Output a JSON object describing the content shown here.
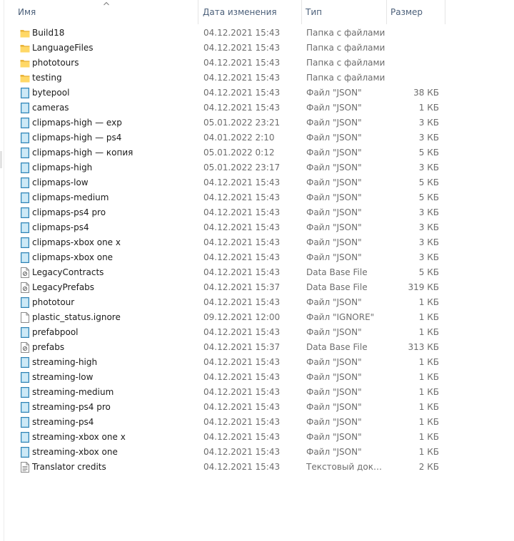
{
  "columns": {
    "name": "Имя",
    "date": "Дата изменения",
    "type": "Тип",
    "size": "Размер"
  },
  "files": [
    {
      "name": "Build18",
      "date": "04.12.2021 15:43",
      "type": "Папка с файлами",
      "size": "",
      "icon": "folder-icon"
    },
    {
      "name": "LanguageFiles",
      "date": "04.12.2021 15:43",
      "type": "Папка с файлами",
      "size": "",
      "icon": "folder-icon"
    },
    {
      "name": "phototours",
      "date": "04.12.2021 15:43",
      "type": "Папка с файлами",
      "size": "",
      "icon": "folder-icon"
    },
    {
      "name": "testing",
      "date": "04.12.2021 15:43",
      "type": "Папка с файлами",
      "size": "",
      "icon": "folder-icon"
    },
    {
      "name": "bytepool",
      "date": "04.12.2021 15:43",
      "type": "Файл \"JSON\"",
      "size": "38 КБ",
      "icon": "json-file-icon"
    },
    {
      "name": "cameras",
      "date": "04.12.2021 15:43",
      "type": "Файл \"JSON\"",
      "size": "1 КБ",
      "icon": "json-file-icon"
    },
    {
      "name": "clipmaps-high — exp",
      "date": "05.01.2022 23:21",
      "type": "Файл \"JSON\"",
      "size": "3 КБ",
      "icon": "json-file-icon"
    },
    {
      "name": "clipmaps-high — ps4",
      "date": "04.01.2022 2:10",
      "type": "Файл \"JSON\"",
      "size": "3 КБ",
      "icon": "json-file-icon"
    },
    {
      "name": "clipmaps-high — копия",
      "date": "05.01.2022 0:12",
      "type": "Файл \"JSON\"",
      "size": "5 КБ",
      "icon": "json-file-icon"
    },
    {
      "name": "clipmaps-high",
      "date": "05.01.2022 23:17",
      "type": "Файл \"JSON\"",
      "size": "3 КБ",
      "icon": "json-file-icon"
    },
    {
      "name": "clipmaps-low",
      "date": "04.12.2021 15:43",
      "type": "Файл \"JSON\"",
      "size": "5 КБ",
      "icon": "json-file-icon"
    },
    {
      "name": "clipmaps-medium",
      "date": "04.12.2021 15:43",
      "type": "Файл \"JSON\"",
      "size": "5 КБ",
      "icon": "json-file-icon"
    },
    {
      "name": "clipmaps-ps4 pro",
      "date": "04.12.2021 15:43",
      "type": "Файл \"JSON\"",
      "size": "3 КБ",
      "icon": "json-file-icon"
    },
    {
      "name": "clipmaps-ps4",
      "date": "04.12.2021 15:43",
      "type": "Файл \"JSON\"",
      "size": "3 КБ",
      "icon": "json-file-icon"
    },
    {
      "name": "clipmaps-xbox one x",
      "date": "04.12.2021 15:43",
      "type": "Файл \"JSON\"",
      "size": "3 КБ",
      "icon": "json-file-icon"
    },
    {
      "name": "clipmaps-xbox one",
      "date": "04.12.2021 15:43",
      "type": "Файл \"JSON\"",
      "size": "3 КБ",
      "icon": "json-file-icon"
    },
    {
      "name": "LegacyContracts",
      "date": "04.12.2021 15:43",
      "type": "Data Base File",
      "size": "5 КБ",
      "icon": "database-file-icon"
    },
    {
      "name": "LegacyPrefabs",
      "date": "04.12.2021 15:37",
      "type": "Data Base File",
      "size": "319 КБ",
      "icon": "database-file-icon"
    },
    {
      "name": "phototour",
      "date": "04.12.2021 15:43",
      "type": "Файл \"JSON\"",
      "size": "1 КБ",
      "icon": "json-file-icon"
    },
    {
      "name": "plastic_status.ignore",
      "date": "09.12.2021 12:00",
      "type": "Файл \"IGNORE\"",
      "size": "1 КБ",
      "icon": "blank-file-icon"
    },
    {
      "name": "prefabpool",
      "date": "04.12.2021 15:43",
      "type": "Файл \"JSON\"",
      "size": "1 КБ",
      "icon": "json-file-icon"
    },
    {
      "name": "prefabs",
      "date": "04.12.2021 15:37",
      "type": "Data Base File",
      "size": "313 КБ",
      "icon": "database-file-icon"
    },
    {
      "name": "streaming-high",
      "date": "04.12.2021 15:43",
      "type": "Файл \"JSON\"",
      "size": "1 КБ",
      "icon": "json-file-icon"
    },
    {
      "name": "streaming-low",
      "date": "04.12.2021 15:43",
      "type": "Файл \"JSON\"",
      "size": "1 КБ",
      "icon": "json-file-icon"
    },
    {
      "name": "streaming-medium",
      "date": "04.12.2021 15:43",
      "type": "Файл \"JSON\"",
      "size": "1 КБ",
      "icon": "json-file-icon"
    },
    {
      "name": "streaming-ps4 pro",
      "date": "04.12.2021 15:43",
      "type": "Файл \"JSON\"",
      "size": "1 КБ",
      "icon": "json-file-icon"
    },
    {
      "name": "streaming-ps4",
      "date": "04.12.2021 15:43",
      "type": "Файл \"JSON\"",
      "size": "1 КБ",
      "icon": "json-file-icon"
    },
    {
      "name": "streaming-xbox one x",
      "date": "04.12.2021 15:43",
      "type": "Файл \"JSON\"",
      "size": "1 КБ",
      "icon": "json-file-icon"
    },
    {
      "name": "streaming-xbox one",
      "date": "04.12.2021 15:43",
      "type": "Файл \"JSON\"",
      "size": "1 КБ",
      "icon": "json-file-icon"
    },
    {
      "name": "Translator credits",
      "date": "04.12.2021 15:43",
      "type": "Текстовый докум...",
      "size": "2 КБ",
      "icon": "text-file-icon"
    }
  ]
}
